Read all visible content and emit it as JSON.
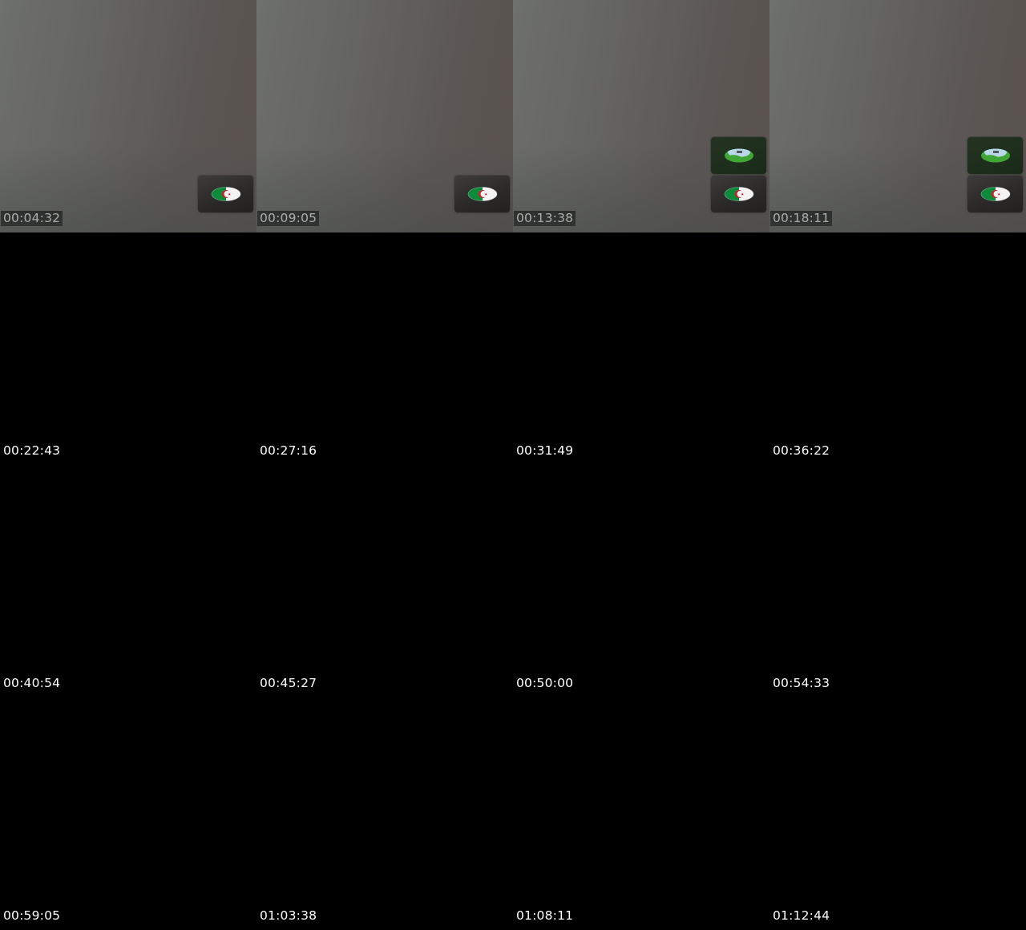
{
  "thumbnails": [
    {
      "timestamp": "00:04:32",
      "frame": true,
      "badges": [
        "flag-icon"
      ]
    },
    {
      "timestamp": "00:09:05",
      "frame": true,
      "badges": [
        "flag-icon"
      ]
    },
    {
      "timestamp": "00:13:38",
      "frame": true,
      "badges": [
        "landscape-icon",
        "flag-icon"
      ]
    },
    {
      "timestamp": "00:18:11",
      "frame": true,
      "badges": [
        "landscape-icon",
        "flag-icon"
      ]
    },
    {
      "timestamp": "00:22:43",
      "frame": false,
      "badges": []
    },
    {
      "timestamp": "00:27:16",
      "frame": false,
      "badges": []
    },
    {
      "timestamp": "00:31:49",
      "frame": false,
      "badges": []
    },
    {
      "timestamp": "00:36:22",
      "frame": false,
      "badges": []
    },
    {
      "timestamp": "00:40:54",
      "frame": false,
      "badges": []
    },
    {
      "timestamp": "00:45:27",
      "frame": false,
      "badges": []
    },
    {
      "timestamp": "00:50:00",
      "frame": false,
      "badges": []
    },
    {
      "timestamp": "00:54:33",
      "frame": false,
      "badges": []
    },
    {
      "timestamp": "00:59:05",
      "frame": false,
      "badges": []
    },
    {
      "timestamp": "01:03:38",
      "frame": false,
      "badges": []
    },
    {
      "timestamp": "01:08:11",
      "frame": false,
      "badges": []
    },
    {
      "timestamp": "01:12:44",
      "frame": false,
      "badges": []
    }
  ],
  "colors": {
    "flag_green": "#0b8a3a",
    "flag_white": "#f4f4f4",
    "flag_red": "#d21f2b",
    "landscape_green": "#3fa535",
    "landscape_sky": "#b9d7e8"
  }
}
